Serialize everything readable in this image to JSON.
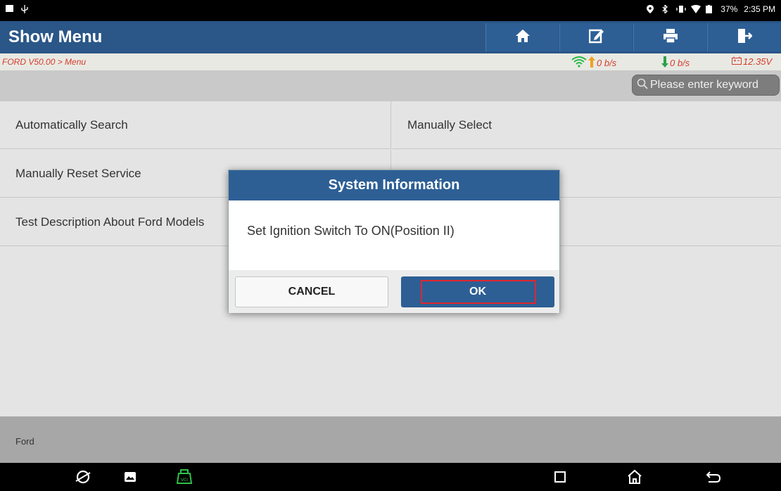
{
  "statusbar": {
    "battery_pct": "37%",
    "time": "2:35 PM"
  },
  "header": {
    "title": "Show Menu",
    "toolbar_icons": [
      "home-icon",
      "edit-report-icon",
      "print-icon",
      "exit-icon"
    ]
  },
  "breadcrumb": {
    "path": "FORD V50.00 > Menu",
    "upload_rate": "0 b/s",
    "download_rate": "0 b/s",
    "voltage": "12.35V"
  },
  "search": {
    "placeholder": "Please enter keyword"
  },
  "menu": {
    "items": [
      {
        "label": "Automatically Search"
      },
      {
        "label": "Manually Select"
      },
      {
        "label": "Manually Reset Service"
      },
      {
        "label": "Test Description About Ford Models"
      }
    ]
  },
  "footer": {
    "text": "Ford"
  },
  "dialog": {
    "title": "System Information",
    "message": "Set Ignition Switch To ON(Position II)",
    "cancel_label": "CANCEL",
    "ok_label": "OK"
  },
  "colors": {
    "header_bg": "#2a5688",
    "button_blue": "#2d5f95",
    "highlight_red": "#e0262d",
    "crumb_red": "#d23c2a"
  }
}
